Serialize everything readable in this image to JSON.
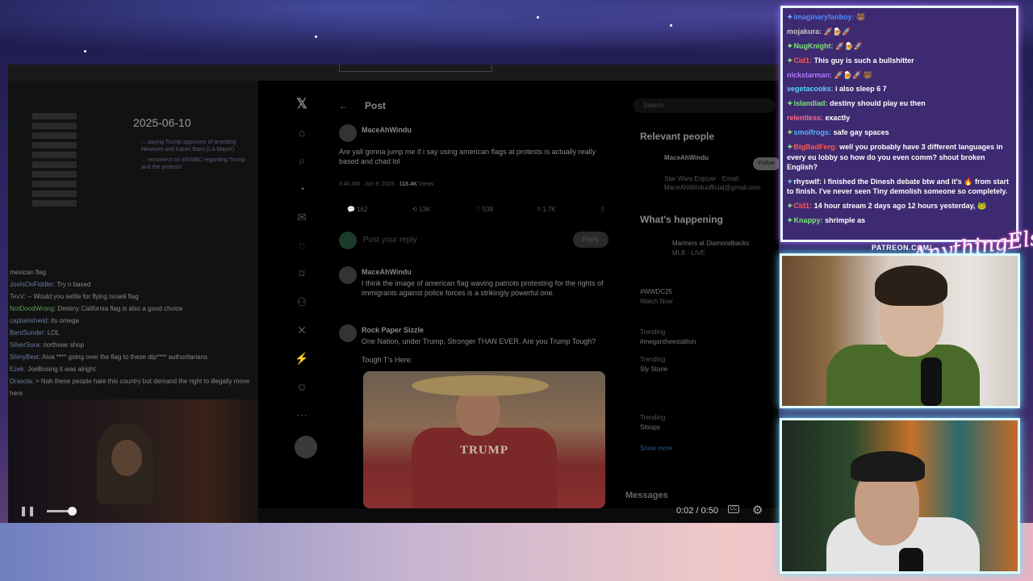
{
  "left_doc": {
    "date": "2025-06-10",
    "lines": [
      "... saying Trump approves of arresting Newsom and Karen Bass (LA Mayor)",
      "... reconnect on MSNBC regarding Trump and the protests"
    ]
  },
  "stream_chat_log": [
    {
      "name": "",
      "text": "mexican flag"
    },
    {
      "name": "JoeIsOnFiddler:",
      "text": "Try n based"
    },
    {
      "name": "TexV:",
      "text": "-- Would you settle for flying Israeli flag"
    },
    {
      "name": "NotDoodWrong:",
      "text": "Destiny California flag is also a good choice"
    },
    {
      "name": "captainshield:",
      "text": "its omega"
    },
    {
      "name": "BentSunder:",
      "text": "LOL"
    },
    {
      "name": "SilverSora:",
      "text": "northwar shop"
    },
    {
      "name": "ShinyBest:",
      "text": "Aiva **** going over the flag to these dip**** authoritarians"
    },
    {
      "name": "Ezek:",
      "text": "JoeBosing it was alright"
    },
    {
      "name": "Drasola:",
      "text": "> Nah these people hate this country but demand the right to illegally move here"
    }
  ],
  "x_app": {
    "header": "Post",
    "tweets": [
      {
        "author": "MaceAhWindu",
        "text": "Are yall gonna jump me if i say using american flags at protests is actually really based and chad lol"
      },
      {
        "author": "MaceAhWindu",
        "text": "I think the image of american flag waving patriots protesting for the rights of immigrants against police forces is a strikingly powerful one."
      },
      {
        "author": "Rock Paper Sizzle",
        "text": "One Nation, under Trump, Stronger THAN EVER. Are you Trump Tough?"
      },
      {
        "author": "",
        "text": "Tough T's Here:"
      }
    ],
    "stats": {
      "time": "3:40 AM · Jun 9, 2025",
      "views": "118.4K",
      "views_label": "Views"
    },
    "actions": [
      "162",
      "13K",
      "538",
      "1.7K"
    ],
    "reply_placeholder": "Post your reply",
    "reply_button": "Reply",
    "shirt_text": "TRUMP",
    "search_placeholder": "Search",
    "relevant_people": "Relevant people",
    "person_name": "MaceAhWindu",
    "person_bio": "Star Wars Enjoyer · Email: MaceAhWinduofficial@gmail.com",
    "follow": "Follow",
    "whats_happening": "What's happening",
    "trends": [
      {
        "title": "Mariners at Diamondbacks",
        "sub": "MLB · LIVE"
      },
      {
        "title": "#WWDC25",
        "sub": "Watch Now"
      },
      {
        "title": "#megantheestallion",
        "sub": "Trending"
      },
      {
        "title": "Sly Stone",
        "sub": "Trending"
      },
      {
        "title": "Stoops",
        "sub": "Trending"
      }
    ],
    "show_more": "Show more",
    "messages": "Messages"
  },
  "player": {
    "time": "0:02 / 0:50",
    "cc": "CC"
  },
  "chat": [
    {
      "name": "imaginaryfanboy:",
      "name_color": "#4f8cff",
      "text": "",
      "badge": "✦"
    },
    {
      "name": "mojakura:",
      "name_color": "#c8c8c8",
      "text": "",
      "badge": ""
    },
    {
      "name": "NugKnight:",
      "name_color": "#7ee37e",
      "text": "",
      "badge": "✦"
    },
    {
      "name": "Cid1:",
      "name_color": "#ff5a5a",
      "text": "This guy is such a bullshitter",
      "badge": "✦"
    },
    {
      "name": "nickstarman:",
      "name_color": "#b07aff",
      "text": "",
      "badge": ""
    },
    {
      "name": "vegetacooks:",
      "name_color": "#5ad2ff",
      "text": "i also sleep 6 7",
      "badge": ""
    },
    {
      "name": "islandlad:",
      "name_color": "#7ee37e",
      "text": "destiny should play eu then",
      "badge": "✦"
    },
    {
      "name": "relentless:",
      "name_color": "#ff6a8a",
      "text": "exactly",
      "badge": ""
    },
    {
      "name": "smolfrogs:",
      "name_color": "#4fb4ff",
      "text": "safe gay spaces",
      "badge": "✦"
    },
    {
      "name": "BigBadFerg:",
      "name_color": "#ff5a5a",
      "text": "well you probably have 3 different languages in every eu lobby so how do you even comm? shout broken English?",
      "badge": "✦"
    },
    {
      "name": "rhyswlf:",
      "name_color": "#ffffff",
      "text": "i finished the Dinesh debate btw and it's 🔥 from start to finish. I've never seen Tiny demolish someone so completely.",
      "badge": "✦"
    },
    {
      "name": "Cid1:",
      "name_color": "#ff5a5a",
      "text": "14 hour stream 2 days ago 12 hours yesterday,",
      "badge": "✦"
    },
    {
      "name": "Knappy:",
      "name_color": "#7ee37e",
      "text": "shrimple as",
      "badge": "✦"
    }
  ],
  "overlay": {
    "patreon": "PATREON.COM/",
    "script": "AnythingElse"
  },
  "colors": {
    "chat_bg": "#3e2a70",
    "cam_border": "#e0ffff",
    "glow": "#66e6ff"
  }
}
